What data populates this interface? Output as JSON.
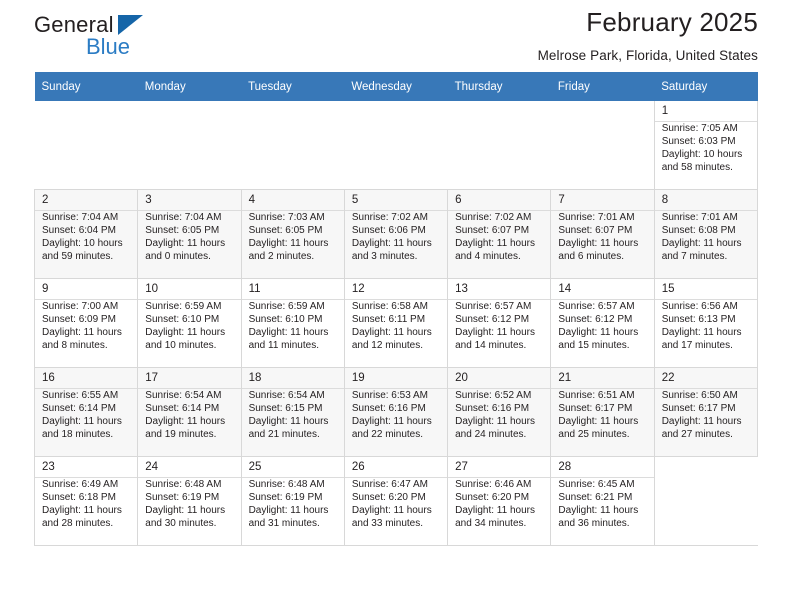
{
  "brand": {
    "name_part1": "General",
    "name_part2": "Blue",
    "triangle_icon": "brand-triangle-icon",
    "accent_color": "#2b7cc4"
  },
  "header": {
    "title": "February 2025",
    "subtitle": "Melrose Park, Florida, United States"
  },
  "calendar": {
    "header_bg": "#3878b8",
    "weekdays": [
      "Sunday",
      "Monday",
      "Tuesday",
      "Wednesday",
      "Thursday",
      "Friday",
      "Saturday"
    ],
    "labels": {
      "sunrise": "Sunrise:",
      "sunset": "Sunset:",
      "daylight": "Daylight:"
    },
    "weeks": [
      {
        "shaded": false,
        "days": [
          null,
          null,
          null,
          null,
          null,
          null,
          {
            "date": "1",
            "sunrise": "Sunrise: 7:05 AM",
            "sunset": "Sunset: 6:03 PM",
            "daylight_line1": "Daylight: 10 hours",
            "daylight_line2": "and 58 minutes."
          }
        ]
      },
      {
        "shaded": true,
        "days": [
          {
            "date": "2",
            "sunrise": "Sunrise: 7:04 AM",
            "sunset": "Sunset: 6:04 PM",
            "daylight_line1": "Daylight: 10 hours",
            "daylight_line2": "and 59 minutes."
          },
          {
            "date": "3",
            "sunrise": "Sunrise: 7:04 AM",
            "sunset": "Sunset: 6:05 PM",
            "daylight_line1": "Daylight: 11 hours",
            "daylight_line2": "and 0 minutes."
          },
          {
            "date": "4",
            "sunrise": "Sunrise: 7:03 AM",
            "sunset": "Sunset: 6:05 PM",
            "daylight_line1": "Daylight: 11 hours",
            "daylight_line2": "and 2 minutes."
          },
          {
            "date": "5",
            "sunrise": "Sunrise: 7:02 AM",
            "sunset": "Sunset: 6:06 PM",
            "daylight_line1": "Daylight: 11 hours",
            "daylight_line2": "and 3 minutes."
          },
          {
            "date": "6",
            "sunrise": "Sunrise: 7:02 AM",
            "sunset": "Sunset: 6:07 PM",
            "daylight_line1": "Daylight: 11 hours",
            "daylight_line2": "and 4 minutes."
          },
          {
            "date": "7",
            "sunrise": "Sunrise: 7:01 AM",
            "sunset": "Sunset: 6:07 PM",
            "daylight_line1": "Daylight: 11 hours",
            "daylight_line2": "and 6 minutes."
          },
          {
            "date": "8",
            "sunrise": "Sunrise: 7:01 AM",
            "sunset": "Sunset: 6:08 PM",
            "daylight_line1": "Daylight: 11 hours",
            "daylight_line2": "and 7 minutes."
          }
        ]
      },
      {
        "shaded": false,
        "days": [
          {
            "date": "9",
            "sunrise": "Sunrise: 7:00 AM",
            "sunset": "Sunset: 6:09 PM",
            "daylight_line1": "Daylight: 11 hours",
            "daylight_line2": "and 8 minutes."
          },
          {
            "date": "10",
            "sunrise": "Sunrise: 6:59 AM",
            "sunset": "Sunset: 6:10 PM",
            "daylight_line1": "Daylight: 11 hours",
            "daylight_line2": "and 10 minutes."
          },
          {
            "date": "11",
            "sunrise": "Sunrise: 6:59 AM",
            "sunset": "Sunset: 6:10 PM",
            "daylight_line1": "Daylight: 11 hours",
            "daylight_line2": "and 11 minutes."
          },
          {
            "date": "12",
            "sunrise": "Sunrise: 6:58 AM",
            "sunset": "Sunset: 6:11 PM",
            "daylight_line1": "Daylight: 11 hours",
            "daylight_line2": "and 12 minutes."
          },
          {
            "date": "13",
            "sunrise": "Sunrise: 6:57 AM",
            "sunset": "Sunset: 6:12 PM",
            "daylight_line1": "Daylight: 11 hours",
            "daylight_line2": "and 14 minutes."
          },
          {
            "date": "14",
            "sunrise": "Sunrise: 6:57 AM",
            "sunset": "Sunset: 6:12 PM",
            "daylight_line1": "Daylight: 11 hours",
            "daylight_line2": "and 15 minutes."
          },
          {
            "date": "15",
            "sunrise": "Sunrise: 6:56 AM",
            "sunset": "Sunset: 6:13 PM",
            "daylight_line1": "Daylight: 11 hours",
            "daylight_line2": "and 17 minutes."
          }
        ]
      },
      {
        "shaded": true,
        "days": [
          {
            "date": "16",
            "sunrise": "Sunrise: 6:55 AM",
            "sunset": "Sunset: 6:14 PM",
            "daylight_line1": "Daylight: 11 hours",
            "daylight_line2": "and 18 minutes."
          },
          {
            "date": "17",
            "sunrise": "Sunrise: 6:54 AM",
            "sunset": "Sunset: 6:14 PM",
            "daylight_line1": "Daylight: 11 hours",
            "daylight_line2": "and 19 minutes."
          },
          {
            "date": "18",
            "sunrise": "Sunrise: 6:54 AM",
            "sunset": "Sunset: 6:15 PM",
            "daylight_line1": "Daylight: 11 hours",
            "daylight_line2": "and 21 minutes."
          },
          {
            "date": "19",
            "sunrise": "Sunrise: 6:53 AM",
            "sunset": "Sunset: 6:16 PM",
            "daylight_line1": "Daylight: 11 hours",
            "daylight_line2": "and 22 minutes."
          },
          {
            "date": "20",
            "sunrise": "Sunrise: 6:52 AM",
            "sunset": "Sunset: 6:16 PM",
            "daylight_line1": "Daylight: 11 hours",
            "daylight_line2": "and 24 minutes."
          },
          {
            "date": "21",
            "sunrise": "Sunrise: 6:51 AM",
            "sunset": "Sunset: 6:17 PM",
            "daylight_line1": "Daylight: 11 hours",
            "daylight_line2": "and 25 minutes."
          },
          {
            "date": "22",
            "sunrise": "Sunrise: 6:50 AM",
            "sunset": "Sunset: 6:17 PM",
            "daylight_line1": "Daylight: 11 hours",
            "daylight_line2": "and 27 minutes."
          }
        ]
      },
      {
        "shaded": false,
        "days": [
          {
            "date": "23",
            "sunrise": "Sunrise: 6:49 AM",
            "sunset": "Sunset: 6:18 PM",
            "daylight_line1": "Daylight: 11 hours",
            "daylight_line2": "and 28 minutes."
          },
          {
            "date": "24",
            "sunrise": "Sunrise: 6:48 AM",
            "sunset": "Sunset: 6:19 PM",
            "daylight_line1": "Daylight: 11 hours",
            "daylight_line2": "and 30 minutes."
          },
          {
            "date": "25",
            "sunrise": "Sunrise: 6:48 AM",
            "sunset": "Sunset: 6:19 PM",
            "daylight_line1": "Daylight: 11 hours",
            "daylight_line2": "and 31 minutes."
          },
          {
            "date": "26",
            "sunrise": "Sunrise: 6:47 AM",
            "sunset": "Sunset: 6:20 PM",
            "daylight_line1": "Daylight: 11 hours",
            "daylight_line2": "and 33 minutes."
          },
          {
            "date": "27",
            "sunrise": "Sunrise: 6:46 AM",
            "sunset": "Sunset: 6:20 PM",
            "daylight_line1": "Daylight: 11 hours",
            "daylight_line2": "and 34 minutes."
          },
          {
            "date": "28",
            "sunrise": "Sunrise: 6:45 AM",
            "sunset": "Sunset: 6:21 PM",
            "daylight_line1": "Daylight: 11 hours",
            "daylight_line2": "and 36 minutes."
          },
          null
        ]
      }
    ]
  }
}
